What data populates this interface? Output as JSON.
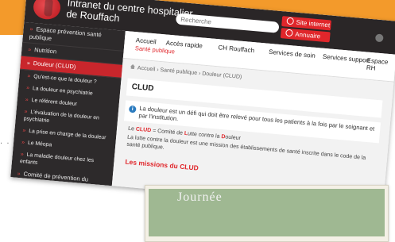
{
  "site": {
    "title_line1": "Intranet du centre hospitalier",
    "title_line2": "de Rouffach",
    "search_placeholder": "Recherche",
    "btn_site_internet": "Site internet",
    "btn_annuaire": "Annuaire"
  },
  "sidebar": {
    "items": [
      {
        "label": "Espace prévention santé publique",
        "level": 1
      },
      {
        "label": "Nutrition",
        "level": 1
      },
      {
        "label": "Douleur (CLUD)",
        "level": 1,
        "active": true
      },
      {
        "label": "Qu'est-ce que la douleur ?",
        "level": 2
      },
      {
        "label": "La douleur en psychiatrie",
        "level": 2
      },
      {
        "label": "Le référent douleur",
        "level": 2
      },
      {
        "label": "L'évaluation de la douleur en psychiatrie",
        "level": 2
      },
      {
        "label": "La prise en charge de la douleur",
        "level": 2
      },
      {
        "label": "Le Méopa",
        "level": 2
      },
      {
        "label": "La maladie douleur chez les enfants",
        "level": 2
      },
      {
        "label": "Comité de prévention du tabagisme",
        "level": 1
      }
    ]
  },
  "nav": {
    "items": [
      "Accueil",
      "Accès rapide",
      "CH Rouffach",
      "Services de soin",
      "Services support",
      "Espace RH"
    ],
    "sub_label": "Santé publique"
  },
  "content": {
    "breadcrumb": "Accueil › Santé publique › Douleur (CLUD)",
    "page_title": "CLUD",
    "info_text": "La douleur est un défi qui doit être relevé pour tous les patients à la fois par le soignant et par l'institution.",
    "para1_pre": "Le ",
    "para1_clud": "CLUD",
    "para1_mid1": " = Comité de ",
    "para1_l": "L",
    "para1_mid2": "utte contre la ",
    "para1_d": "D",
    "para1_end": "ouleur",
    "para2": "La lutte contre la douleur est une mission des établissements de santé inscrite dans le code de la santé publique.",
    "section_title": "Les missions du CLUD"
  },
  "poster": {
    "title": "Journée"
  },
  "colors": {
    "accent_orange": "#f39a2b",
    "brand_red": "#e0262b",
    "dark_bg": "#2a2627"
  }
}
